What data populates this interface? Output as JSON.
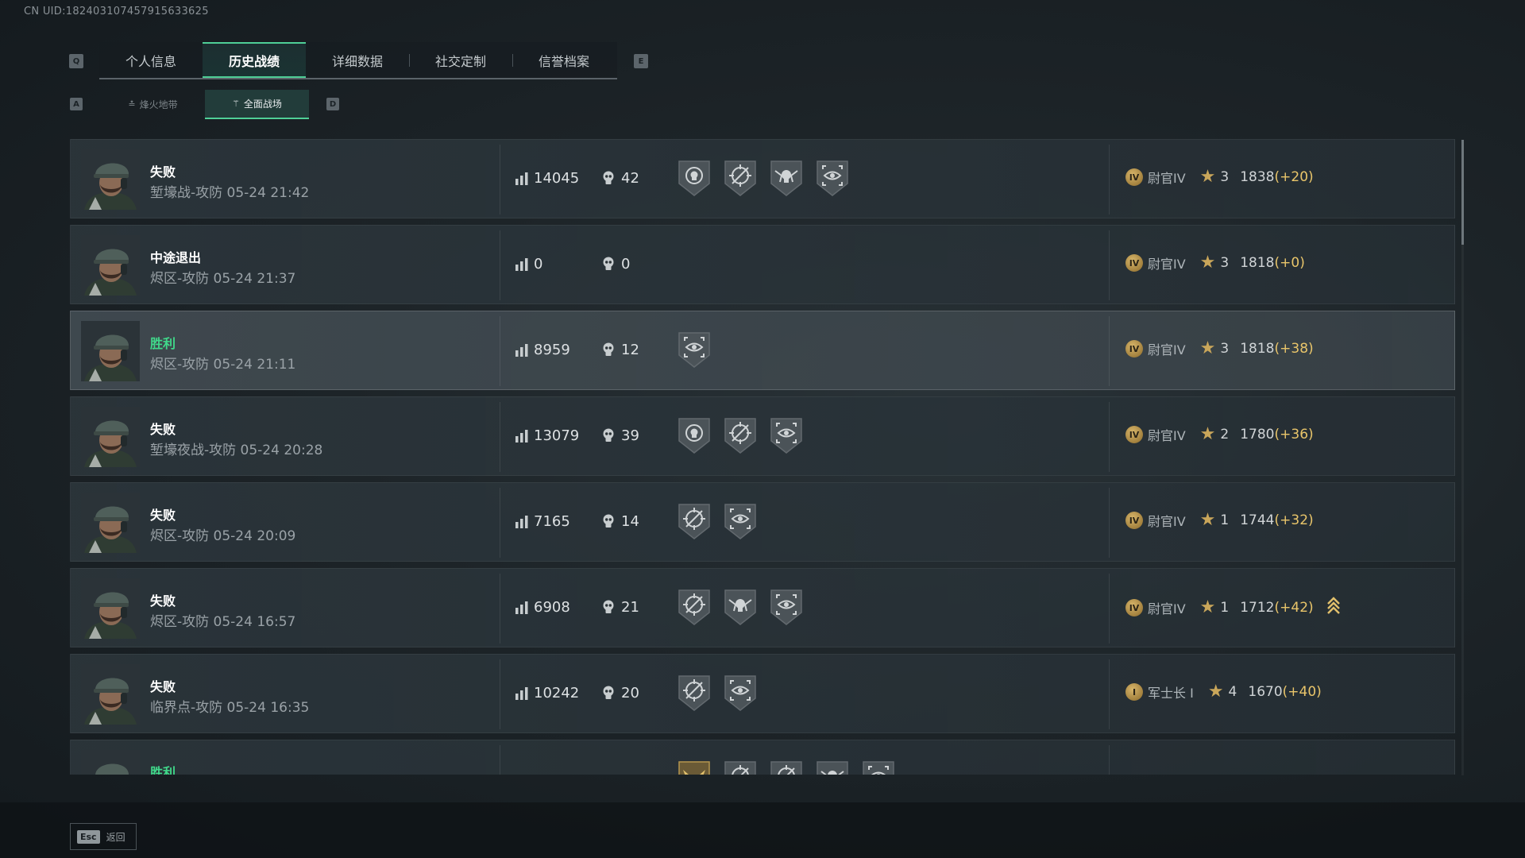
{
  "uid": "CN UID:18240310745791563362​5",
  "tabs": {
    "prev_key": "Q",
    "next_key": "E",
    "items": [
      {
        "label": "个人信息",
        "active": false
      },
      {
        "label": "历史战绩",
        "active": true
      },
      {
        "label": "详细数据",
        "active": false
      },
      {
        "label": "社交定制",
        "active": false
      },
      {
        "label": "信誉档案",
        "active": false
      }
    ]
  },
  "subtabs": {
    "prev_key": "A",
    "next_key": "D",
    "items": [
      {
        "label": "烽火地带",
        "active": false
      },
      {
        "label": "全面战场",
        "active": true
      }
    ]
  },
  "matches": [
    {
      "result": "失败",
      "win": false,
      "mode": "堑壕战-攻防 05-24 21:42",
      "score": "14045",
      "kills": "42",
      "badges": [
        "skull-target-badge",
        "crossed-sight-badge",
        "winged-skull-badge",
        "eye-scope-badge"
      ],
      "rank_emblem": "IV",
      "rank": "尉官IV",
      "tier": "3",
      "points": "1838",
      "delta": "(+20)",
      "highlight": false,
      "promoted": false
    },
    {
      "result": "中途退出",
      "win": false,
      "mode": "烬区-攻防 05-24 21:37",
      "score": "0",
      "kills": "0",
      "badges": [],
      "rank_emblem": "IV",
      "rank": "尉官IV",
      "tier": "3",
      "points": "1818",
      "delta": "(+0)",
      "highlight": false,
      "promoted": false
    },
    {
      "result": "胜利",
      "win": true,
      "mode": "烬区-攻防 05-24 21:11",
      "score": "8959",
      "kills": "12",
      "badges": [
        "eye-scope-badge"
      ],
      "rank_emblem": "IV",
      "rank": "尉官IV",
      "tier": "3",
      "points": "1818",
      "delta": "(+38)",
      "highlight": true,
      "promoted": false
    },
    {
      "result": "失败",
      "win": false,
      "mode": "堑壕夜战-攻防 05-24 20:28",
      "score": "13079",
      "kills": "39",
      "badges": [
        "skull-target-badge",
        "crossed-sight-badge",
        "eye-scope-badge"
      ],
      "rank_emblem": "IV",
      "rank": "尉官IV",
      "tier": "2",
      "points": "1780",
      "delta": "(+36)",
      "highlight": false,
      "promoted": false
    },
    {
      "result": "失败",
      "win": false,
      "mode": "烬区-攻防 05-24 20:09",
      "score": "7165",
      "kills": "14",
      "badges": [
        "crossed-sight-badge",
        "eye-scope-badge"
      ],
      "rank_emblem": "IV",
      "rank": "尉官IV",
      "tier": "1",
      "points": "1744",
      "delta": "(+32)",
      "highlight": false,
      "promoted": false
    },
    {
      "result": "失败",
      "win": false,
      "mode": "烬区-攻防 05-24 16:57",
      "score": "6908",
      "kills": "21",
      "badges": [
        "crossed-sight-badge",
        "winged-skull-badge",
        "eye-scope-badge"
      ],
      "rank_emblem": "IV",
      "rank": "尉官IV",
      "tier": "1",
      "points": "1712",
      "delta": "(+42)",
      "highlight": false,
      "promoted": true
    },
    {
      "result": "失败",
      "win": false,
      "mode": "临界点-攻防 05-24 16:35",
      "score": "10242",
      "kills": "20",
      "badges": [
        "crossed-sight-badge",
        "eye-scope-badge"
      ],
      "rank_emblem": "I",
      "rank": "军士长 I",
      "tier": "4",
      "points": "1670",
      "delta": "(+40)",
      "highlight": false,
      "promoted": false
    },
    {
      "result": "胜利",
      "win": true,
      "mode": "",
      "score": "",
      "kills": "",
      "badges": [
        "gold-wings-badge",
        "crossed-sight-badge",
        "crossed-sight-badge",
        "winged-skull-badge",
        "eye-scope-badge"
      ],
      "rank_emblem": "",
      "rank": "",
      "tier": "",
      "points": "",
      "delta": "",
      "highlight": false,
      "promoted": false
    }
  ],
  "footer": {
    "esc_key": "Esc",
    "back_label": "返回"
  },
  "colors": {
    "accent_green": "#4fcf97",
    "win_green": "#40d88a",
    "delta_gold": "#e9c56a"
  }
}
